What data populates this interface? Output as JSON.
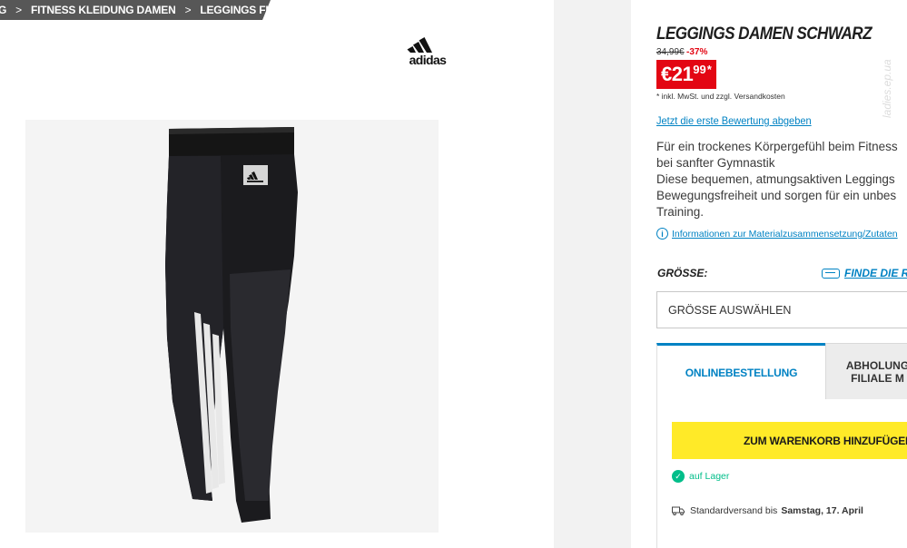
{
  "breadcrumb": {
    "items": [
      {
        "label": "G"
      },
      {
        "label": "FITNESS KLEIDUNG DAMEN"
      },
      {
        "label": "LEGGINGS FITNESS"
      }
    ],
    "separator": ">"
  },
  "brand": {
    "name": "adidas"
  },
  "product": {
    "title": "LEGGINGS DAMEN SCHWARZ",
    "old_price": "34,99€",
    "discount": "-37%",
    "price_main": "€21",
    "price_cents": "99",
    "price_star": "*",
    "tax_note": "* inkl. MwSt. und zzgl. Versandkosten",
    "review_link": "Jetzt die erste Bewertung abgeben",
    "description": [
      "Für ein trockenes Körpergefühl beim Fitness",
      "bei sanfter Gymnastik",
      "Diese bequemen, atmungsaktiven Leggings",
      "Bewegungsfreiheit und sorgen für ein unbes",
      "Training."
    ],
    "info_link": "Informationen zur Materialzusammensetzung/Zutaten",
    "info_icon": "info-circle-icon",
    "colors": {
      "accent": "#0082c3",
      "price_bg": "#e30613",
      "cart_button": "#ffea28",
      "stock_green": "#02be8a"
    }
  },
  "size": {
    "label": "GRÖSSE:",
    "guide_link": "FINDE DIE R",
    "guide_icon": "measuring-tape-icon",
    "select_placeholder": "GRÖSSE AUSWÄHLEN"
  },
  "tabs": {
    "online": "ONLINEBESTELLUNG",
    "pickup_line1": "ABHOLUNG",
    "pickup_line2": "FILIALE M"
  },
  "cart": {
    "button_label": "ZUM WARENKORB HINZUFÜGEN"
  },
  "stock": {
    "icon": "check-circle-icon",
    "label": "auf Lager"
  },
  "shipping": {
    "icon": "truck-icon",
    "label": "Standardversand bis",
    "date": "Samstag, 17. April"
  },
  "watermark": "ladies.ep.ua"
}
